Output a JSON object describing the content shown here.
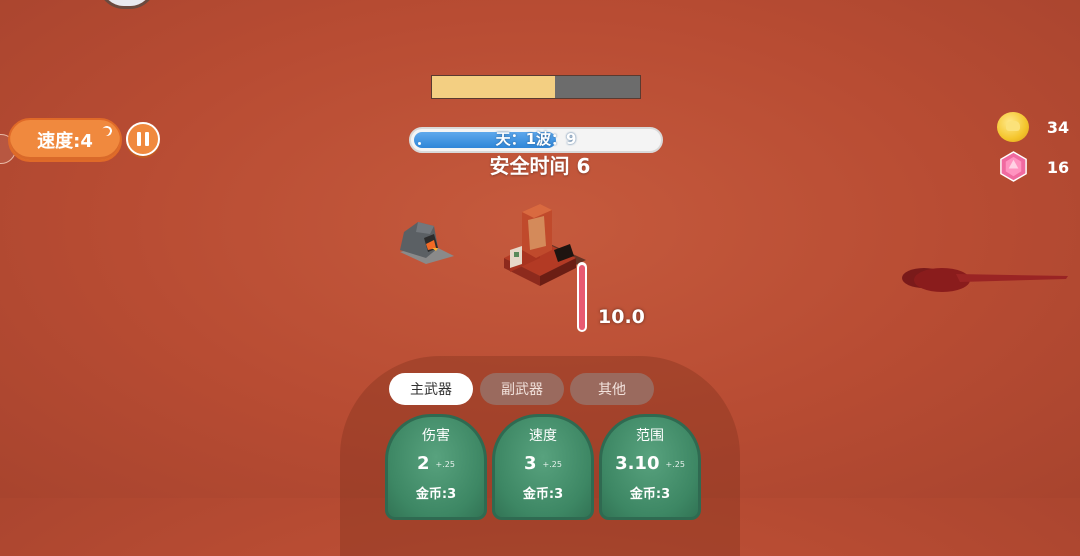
{
  "wave_progress": {
    "fraction": 0.59
  },
  "hud": {
    "speed_label": "速度:4",
    "wave_label": "天：1波：9",
    "wave_fraction": 0.58,
    "safe_time": "安全时间  6"
  },
  "currency": {
    "coins": "34",
    "gems": "16"
  },
  "base": {
    "health_value": "10.0",
    "health_fraction": 0.98
  },
  "panel": {
    "tabs": [
      {
        "label": "主武器",
        "active": true
      },
      {
        "label": "副武器",
        "active": false
      },
      {
        "label": "其他",
        "active": false
      }
    ],
    "cards": [
      {
        "title": "伤害",
        "value": "2",
        "increment": "+.25",
        "cost": "金币:3"
      },
      {
        "title": "速度",
        "value": "3",
        "increment": "+.25",
        "cost": "金币:3"
      },
      {
        "title": "范围",
        "value": "3.10",
        "increment": "+.25",
        "cost": "金币:3"
      }
    ]
  },
  "colors": {
    "background": "#b84c33",
    "accent_orange": "#f0893e",
    "wave_blue": "#2f86d8",
    "card_green": "#3d8764",
    "hp_red": "#e85a72",
    "progress_yellow": "#f3cf82"
  },
  "icons": [
    "pause-icon",
    "coin-icon",
    "gem-icon",
    "rock-spawner-icon",
    "base-tower-icon"
  ]
}
